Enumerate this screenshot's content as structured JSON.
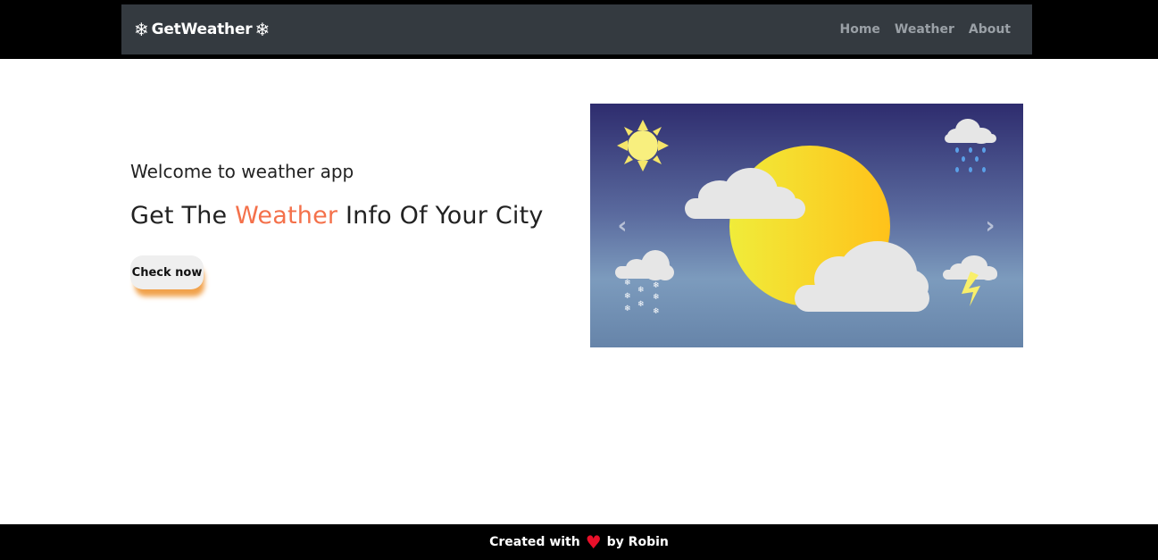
{
  "navbar": {
    "brand_left_icon": "❄",
    "brand": "GetWeather",
    "brand_right_icon": "❄",
    "links": [
      {
        "label": "Home"
      },
      {
        "label": "Weather"
      },
      {
        "label": "About"
      }
    ]
  },
  "hero": {
    "subtitle": "Welcome to weather app",
    "title_prefix": "Get The ",
    "title_accent": "Weather",
    "title_suffix": " Info Of Your City",
    "cta_label": "Check now",
    "colors": {
      "accent": "#f4714b",
      "button_shadow": "#f1a24c"
    }
  },
  "carousel": {
    "prev_icon": "‹",
    "next_icon": "›",
    "slide_icons": [
      "sun-icon",
      "rain-cloud-icon",
      "snow-cloud-icon",
      "thunder-cloud-icon",
      "sun-behind-cloud-icon"
    ]
  },
  "footer": {
    "prefix": "Created with",
    "heart": "♥",
    "suffix": "by Robin"
  }
}
